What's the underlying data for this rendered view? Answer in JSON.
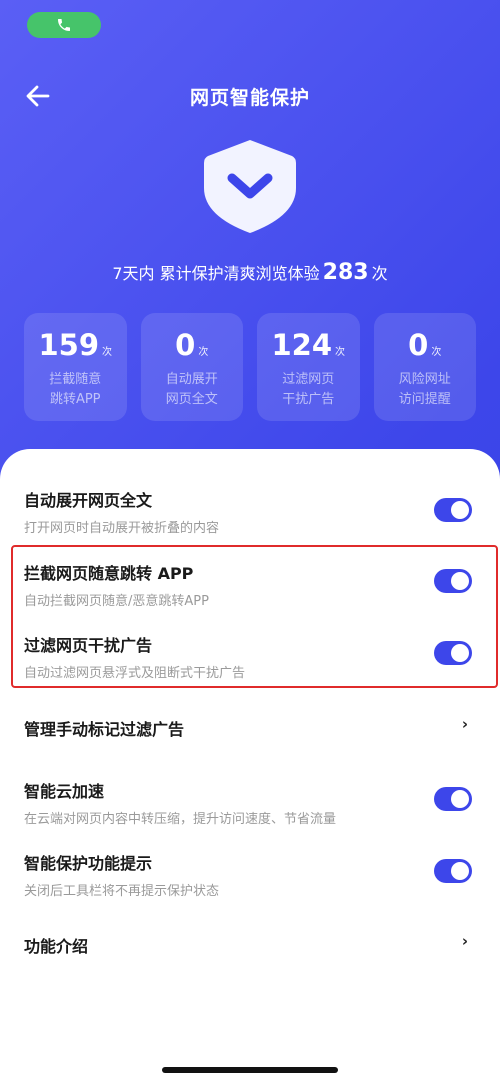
{
  "colors": {
    "accent": "#3d46ea",
    "call_pill": "#46c46a",
    "highlight": "#e02b2b"
  },
  "status": {
    "call_icon": "phone-icon"
  },
  "header": {
    "back_icon": "arrow-left-icon",
    "title": "网页智能保护"
  },
  "hero": {
    "icon": "shield-check-icon"
  },
  "summary": {
    "prefix": "7天内 累计保护清爽浏览体验",
    "count": "283",
    "suffix": "次"
  },
  "stats": [
    {
      "value": "159",
      "unit": "次",
      "label": "拦截随意跳转APP"
    },
    {
      "value": "0",
      "unit": "次",
      "label": "自动展开网页全文"
    },
    {
      "value": "124",
      "unit": "次",
      "label": "过滤网页干扰广告"
    },
    {
      "value": "0",
      "unit": "次",
      "label": "风险网址访问提醒"
    }
  ],
  "settings": [
    {
      "title": "自动展开网页全文",
      "subtitle": "打开网页时自动展开被折叠的内容",
      "control": "toggle",
      "enabled": true
    },
    {
      "title": "拦截网页随意跳转 APP",
      "subtitle": "自动拦截网页随意/恶意跳转APP",
      "control": "toggle",
      "enabled": true
    },
    {
      "title": "过滤网页干扰广告",
      "subtitle": "自动过滤网页悬浮式及阻断式干扰广告",
      "control": "toggle",
      "enabled": true
    },
    {
      "title": "管理手动标记过滤广告",
      "control": "chevron",
      "chevron": "›"
    },
    {
      "title": "智能云加速",
      "subtitle": "在云端对网页内容中转压缩，提升访问速度、节省流量",
      "control": "toggle",
      "enabled": true
    },
    {
      "title": "智能保护功能提示",
      "subtitle": "关闭后工具栏将不再提示保护状态",
      "control": "toggle",
      "enabled": true
    },
    {
      "title": "功能介绍",
      "control": "chevron",
      "chevron": "›"
    }
  ]
}
